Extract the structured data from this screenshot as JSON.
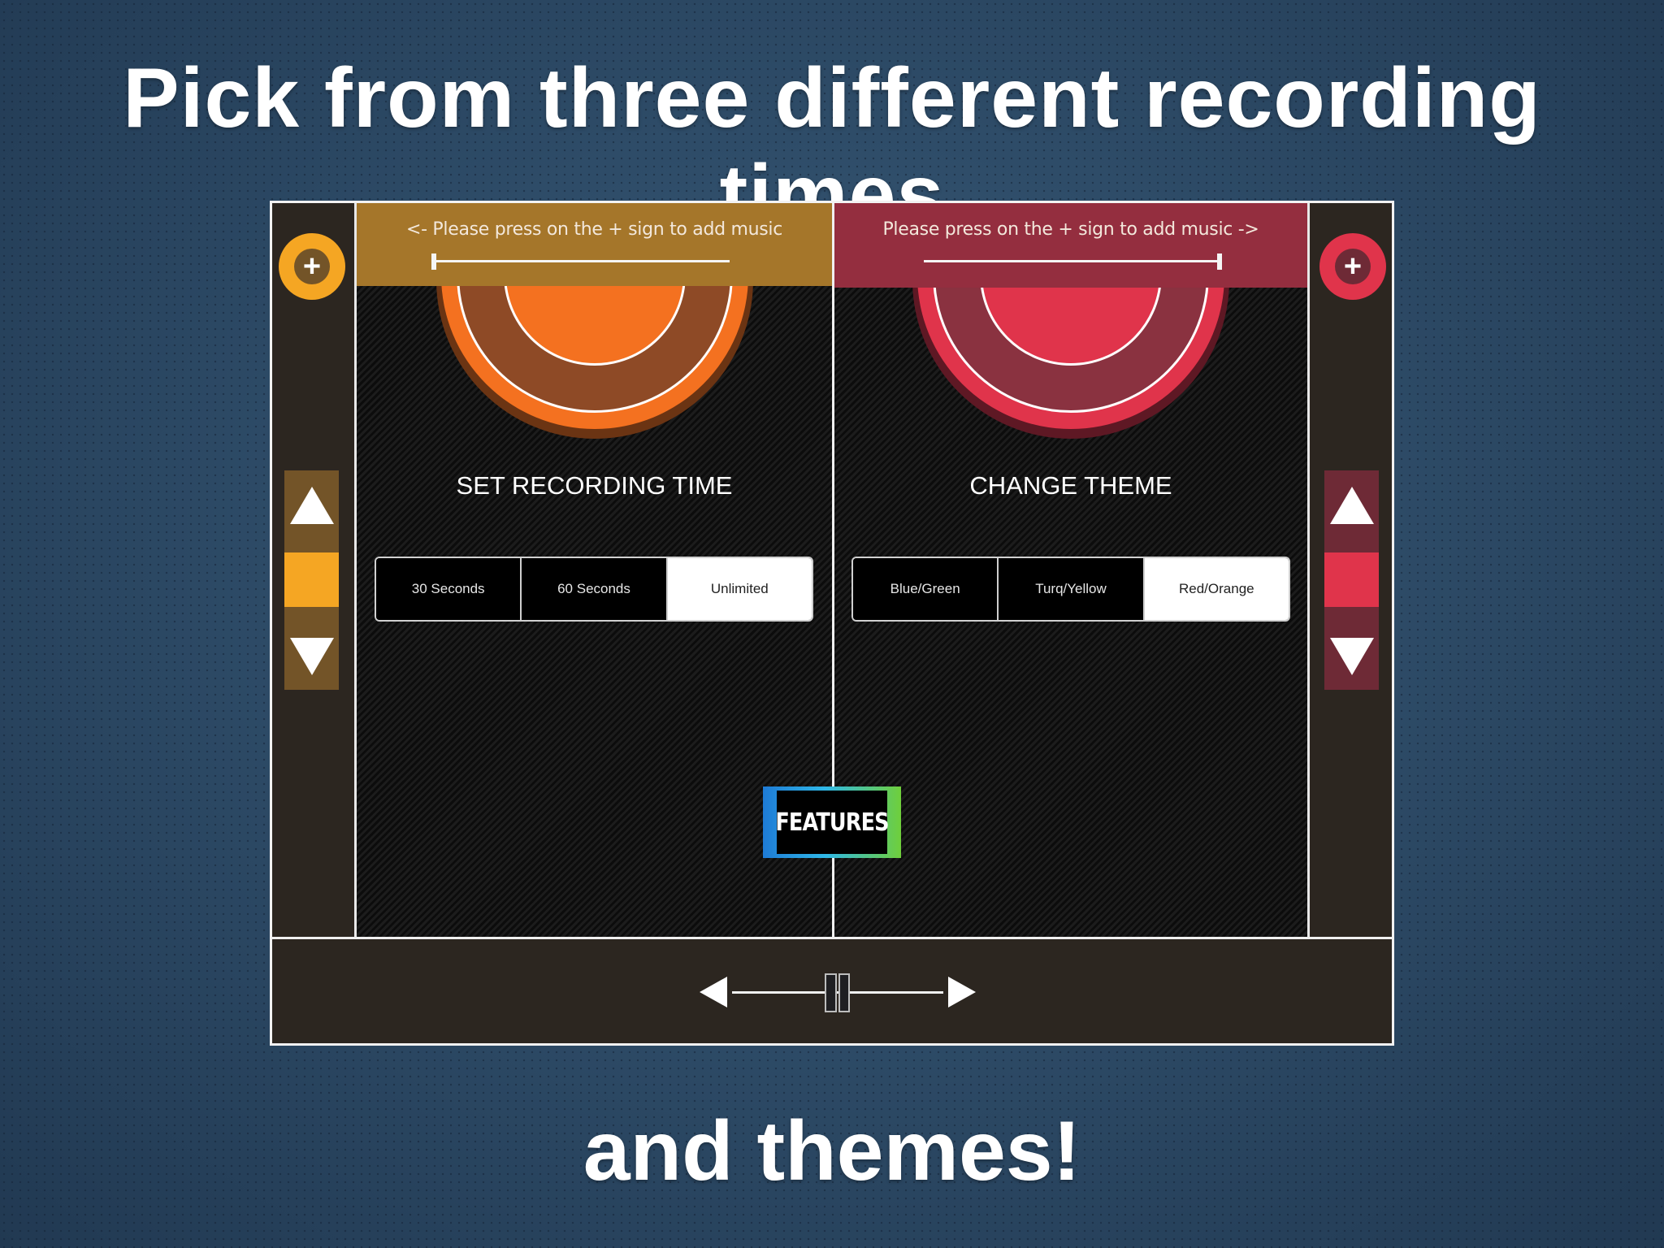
{
  "slide": {
    "headline": "Pick from three different recording times",
    "subline": "and themes!"
  },
  "colors": {
    "left_accent": "#f5a623",
    "left_header": "#a5762a",
    "left_pitch_bg": "#735428",
    "right_accent": "#e0344b",
    "right_header": "#942e3f",
    "right_pitch_bg": "#6e2a36",
    "record_left_outer": "#f47120",
    "record_left_body": "#8e4a26",
    "record_right_outer": "#e0344b",
    "record_right_body": "#8a3240"
  },
  "left_deck": {
    "hint": "<- Please press on the + sign to add music",
    "add_icon": "plus-icon",
    "progress": 0.0,
    "title": "SET RECORDING TIME",
    "options": [
      "30 Seconds",
      "60 Seconds",
      "Unlimited"
    ],
    "selected": "Unlimited",
    "pitch_up_icon": "triangle-up-icon",
    "pitch_down_icon": "triangle-down-icon",
    "pitch_value": 0.5
  },
  "right_deck": {
    "hint": "Please press on the + sign to add music ->",
    "add_icon": "plus-icon",
    "progress": 1.0,
    "title": "CHANGE THEME",
    "options": [
      "Blue/Green",
      "Turq/Yellow",
      "Red/Orange"
    ],
    "selected": "Red/Orange",
    "pitch_up_icon": "triangle-up-icon",
    "pitch_down_icon": "triangle-down-icon",
    "pitch_value": 0.5
  },
  "features_button": {
    "label": "FEATURES"
  },
  "crossfader": {
    "left_icon": "arrow-left-icon",
    "right_icon": "arrow-right-icon",
    "position": 0.5
  }
}
